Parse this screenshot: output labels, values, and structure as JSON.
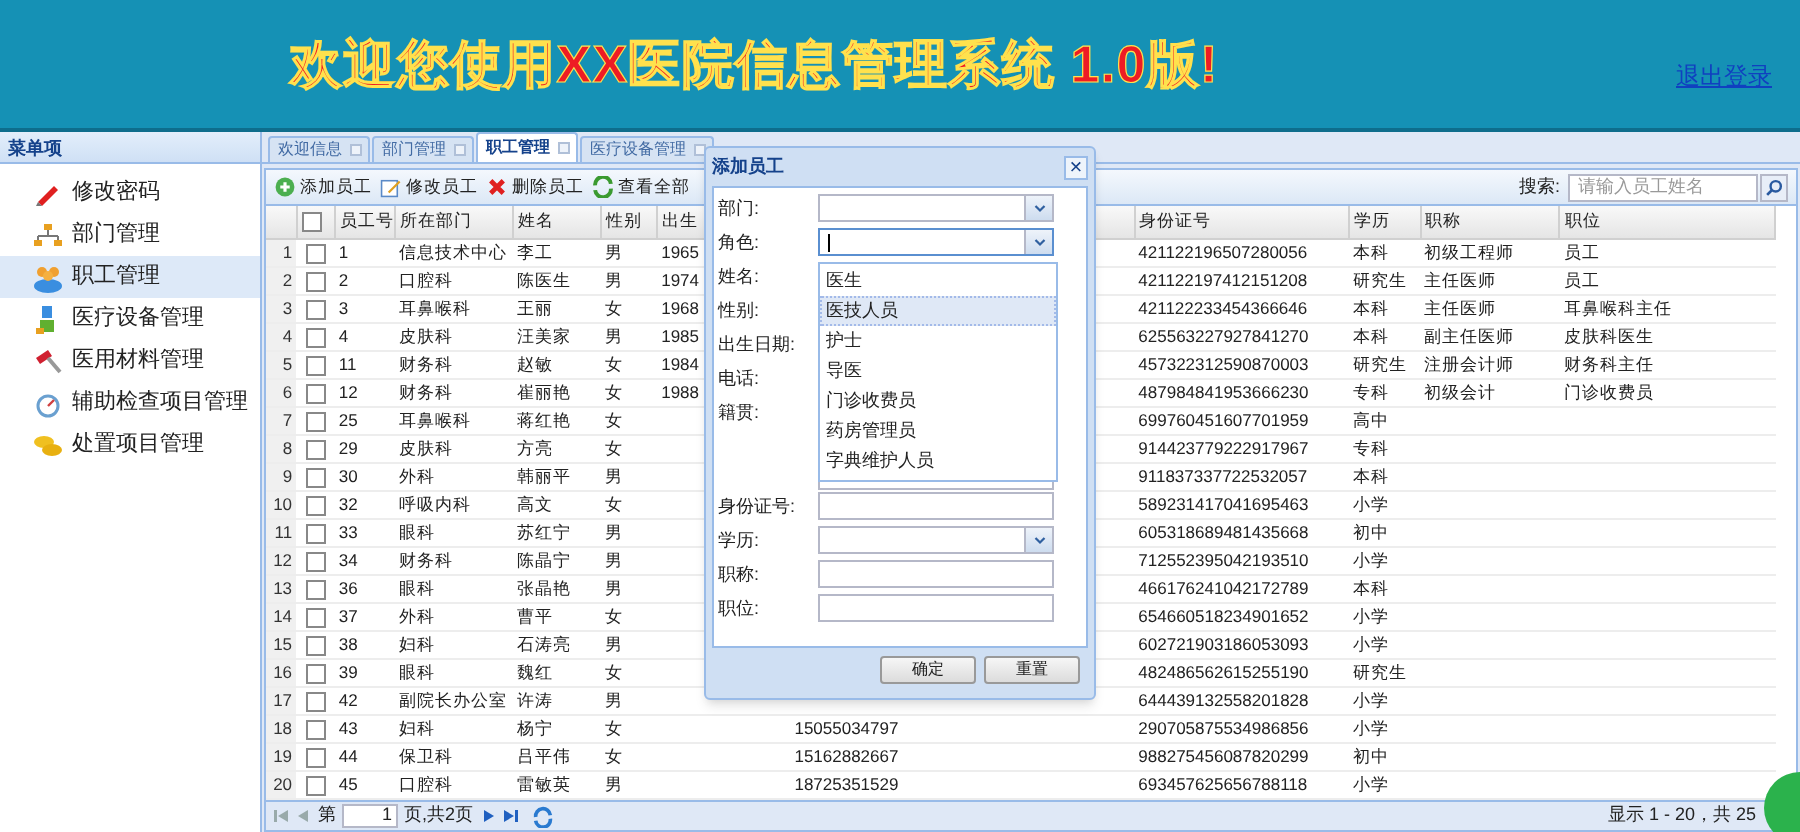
{
  "header": {
    "title": "欢迎您使用XX医院信息管理系统 1.0版!",
    "logout": "退出登录"
  },
  "sidebar": {
    "title": "菜单项",
    "items": [
      {
        "label": "修改密码",
        "selected": false
      },
      {
        "label": "部门管理",
        "selected": false
      },
      {
        "label": "职工管理",
        "selected": true
      },
      {
        "label": "医疗设备管理",
        "selected": false
      },
      {
        "label": "医用材料管理",
        "selected": false
      },
      {
        "label": "辅助检查项目管理",
        "selected": false
      },
      {
        "label": "处置项目管理",
        "selected": false
      }
    ]
  },
  "tabs": [
    {
      "label": "欢迎信息",
      "selected": false
    },
    {
      "label": "部门管理",
      "selected": false
    },
    {
      "label": "职工管理",
      "selected": true
    },
    {
      "label": "医疗设备管理",
      "selected": false
    }
  ],
  "toolbar": [
    "添加员工",
    "修改员工",
    "删除员工",
    "查看全部"
  ],
  "search": {
    "label": "搜索:",
    "placeholder": "请输入员工姓名"
  },
  "table": {
    "header_checked": false,
    "columns": [
      "员工号",
      "所在部门",
      "姓名",
      "性别",
      "出生",
      "身份证号",
      "学历",
      "职称",
      "职位"
    ],
    "rows": [
      {
        "no": "1",
        "checked": false,
        "cells": [
          "1",
          "信息技术中心",
          "李工",
          "男",
          "1965",
          "421122196507280056",
          "本科",
          "初级工程师",
          "员工"
        ]
      },
      {
        "no": "2",
        "checked": false,
        "cells": [
          "2",
          "口腔科",
          "陈医生",
          "男",
          "1974",
          "421122197412151208",
          "研究生",
          "主任医师",
          "员工"
        ]
      },
      {
        "no": "3",
        "checked": false,
        "cells": [
          "3",
          "耳鼻喉科",
          "王丽",
          "女",
          "1968",
          "421122233454366646",
          "本科",
          "主任医师",
          "耳鼻喉科主任"
        ]
      },
      {
        "no": "4",
        "checked": false,
        "cells": [
          "4",
          "皮肤科",
          "汪美家",
          "男",
          "1985",
          "625563227927841270",
          "本科",
          "副主任医师",
          "皮肤科医生"
        ]
      },
      {
        "no": "5",
        "checked": false,
        "cells": [
          "11",
          "财务科",
          "赵敏",
          "女",
          "1984",
          "457322312590870003",
          "研究生",
          "注册会计师",
          "财务科主任"
        ]
      },
      {
        "no": "6",
        "checked": false,
        "cells": [
          "12",
          "财务科",
          "崔丽艳",
          "女",
          "1988",
          "487984841953666230",
          "专科",
          "初级会计",
          "门诊收费员"
        ]
      },
      {
        "no": "7",
        "checked": false,
        "cells": [
          "25",
          "耳鼻喉科",
          "蒋红艳",
          "女",
          null,
          "699760451607701959",
          "高中"
        ]
      },
      {
        "no": "8",
        "checked": false,
        "cells": [
          "29",
          "皮肤科",
          "方亮",
          "女",
          null,
          "914423779222917967",
          "专科"
        ]
      },
      {
        "no": "9",
        "checked": false,
        "cells": [
          "30",
          "外科",
          "韩丽平",
          "男",
          null,
          "911837337722532057",
          "本科"
        ]
      },
      {
        "no": "10",
        "checked": false,
        "cells": [
          "32",
          "呼吸内科",
          "高文",
          "女",
          null,
          "589231417041695463",
          "小学"
        ]
      },
      {
        "no": "11",
        "checked": false,
        "cells": [
          "33",
          "眼科",
          "苏红宁",
          "男",
          null,
          "605318689481435668",
          "初中"
        ]
      },
      {
        "no": "12",
        "checked": false,
        "cells": [
          "34",
          "财务科",
          "陈晶宁",
          "男",
          null,
          "712552395042193510",
          "小学"
        ]
      },
      {
        "no": "13",
        "checked": false,
        "cells": [
          "36",
          "眼科",
          "张晶艳",
          "男",
          null,
          "466176241042172789",
          "本科"
        ]
      },
      {
        "no": "14",
        "checked": false,
        "cells": [
          "37",
          "外科",
          "曹平",
          "女",
          null,
          "654660518234901652",
          "小学"
        ]
      },
      {
        "no": "15",
        "checked": false,
        "cells": [
          "38",
          "妇科",
          "石涛亮",
          "男",
          null,
          "602721903186053093",
          "小学"
        ]
      },
      {
        "no": "16",
        "checked": false,
        "cells": [
          "39",
          "眼科",
          "魏红",
          "女",
          null,
          "482486562615255190",
          "研究生"
        ]
      },
      {
        "no": "17",
        "checked": false,
        "cells": [
          "42",
          "副院长办公室",
          "许涛",
          "男",
          null,
          "644439132558201828",
          "小学"
        ]
      },
      {
        "no": "18",
        "checked": false,
        "cells": [
          "43",
          "妇科",
          "杨宁",
          "女",
          null,
          "290705875534986856",
          "小学"
        ],
        "column_6": "15055034797"
      },
      {
        "no": "19",
        "checked": false,
        "cells": [
          "44",
          "保卫科",
          "吕平伟",
          "女",
          null,
          "988275456087820299",
          "初中"
        ],
        "column_6": "15162882667"
      },
      {
        "no": "20",
        "checked": false,
        "cells": [
          "45",
          "口腔科",
          "雷敏英",
          "男",
          null,
          "693457625656788118",
          "小学"
        ],
        "column_6": "18725351529"
      }
    ]
  },
  "pager": {
    "before": "第",
    "page": "1",
    "after": "页,共2页",
    "summary": "显示 1 - 20，共 25"
  },
  "dialog": {
    "title": "添加员工",
    "close": "×",
    "fields": [
      {
        "label": "部门:",
        "kind": "select"
      },
      {
        "label": "角色:",
        "kind": "select",
        "focused": true,
        "options": [
          {
            "label": "医生",
            "selected": false
          },
          {
            "label": "医技人员",
            "selected": true
          },
          {
            "label": "护士",
            "selected": false
          },
          {
            "label": "导医",
            "selected": false
          },
          {
            "label": "门诊收费员",
            "selected": false
          },
          {
            "label": "药房管理员",
            "selected": false
          },
          {
            "label": "字典维护人员",
            "selected": false
          }
        ]
      },
      {
        "label": "姓名:",
        "kind": "hidden"
      },
      {
        "label": "性别:",
        "kind": "hidden"
      },
      {
        "label": "出生日期:",
        "kind": "hidden"
      },
      {
        "label": "电话:",
        "kind": "hidden"
      },
      {
        "label": "籍贯:",
        "kind": "textarea"
      },
      {
        "label": "身份证号:",
        "kind": "text"
      },
      {
        "label": "学历:",
        "kind": "select"
      },
      {
        "label": "职称:",
        "kind": "text"
      },
      {
        "label": "职位:",
        "kind": "text"
      }
    ],
    "buttons": [
      "确定",
      "重置"
    ]
  }
}
